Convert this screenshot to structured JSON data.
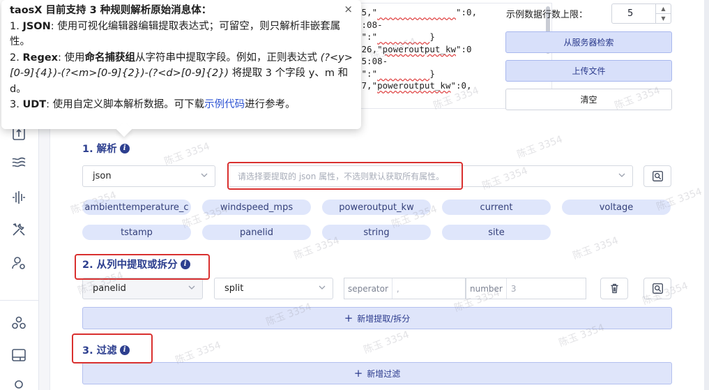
{
  "code_preview": {
    "lines": [
      {
        "pre": ".5,\"",
        "sq": "               ",
        "post": "\":0,"
      },
      {
        "pre": "5:08-",
        "sq": "",
        "post": ""
      },
      {
        "pre": "e\":\"",
        "sq": "          ",
        "post": "}"
      },
      {
        "pre": ".26,\"",
        "sq": "poweroutput_kw",
        "post": "\":0"
      },
      {
        "pre": "45:08-",
        "sq": "",
        "post": ""
      },
      {
        "pre": "e\":\"",
        "sq": "          ",
        "post": "}"
      },
      {
        "pre": ".7,\"",
        "sq": "poweroutput_kw",
        "post": "\":0,"
      }
    ]
  },
  "sample_rows": {
    "label": "示例数据行数上限：",
    "value": "5"
  },
  "buttons": {
    "fetch_server": "从服务器检索",
    "upload_file": "上传文件",
    "clear": "清空"
  },
  "parse": {
    "title": "1. 解析",
    "type_value": "json",
    "attr_placeholder": "请选择要提取的 json 属性，不选则默认获取所有属性。",
    "fields": [
      "ambienttemperature_c",
      "windspeed_mps",
      "poweroutput_kw",
      "current",
      "voltage",
      "tstamp",
      "panelid",
      "string",
      "site"
    ]
  },
  "extract": {
    "title": "2. 从列中提取或拆分",
    "column_value": "panelid",
    "method_value": "split",
    "separator_label": "seperator",
    "separator_value": ",",
    "number_label": "number",
    "number_value": "3",
    "add_label": "新增提取/拆分"
  },
  "filter": {
    "title": "3. 过滤",
    "add_label": "新增过滤"
  },
  "tooltip": {
    "heading": "taosX 目前支持 3 种规则解析原始消息体：",
    "item1_prefix": "1. ",
    "item1_key": "JSON",
    "item1_text": ": 使用可视化编辑器编辑提取表达式；可留空，则只解析非嵌套属性。",
    "item2_prefix": "2. ",
    "item2_key": "Regex",
    "item2_text_a": ": 使用",
    "item2_bold": "命名捕获组",
    "item2_text_b": "从字符串中提取字段。例如，正则表达式",
    "item2_regex": "(?<y>[0-9]{4})-(?<m>[0-9]{2})-(?<d>[0-9]{2})",
    "item2_text_c": "将提取 3 个字段 y、m 和 d。",
    "item3_prefix": "3. ",
    "item3_key": "UDT",
    "item3_text_a": ": 使用自定义脚本解析数据。可下载",
    "item3_link": "示例代码",
    "item3_text_b": "进行参考。",
    "close": "×"
  },
  "watermark": "陈玉 3354",
  "colors": {
    "accent": "#2d3f8f",
    "tag_bg": "#dfe6fb",
    "highlight": "#d9302f"
  }
}
